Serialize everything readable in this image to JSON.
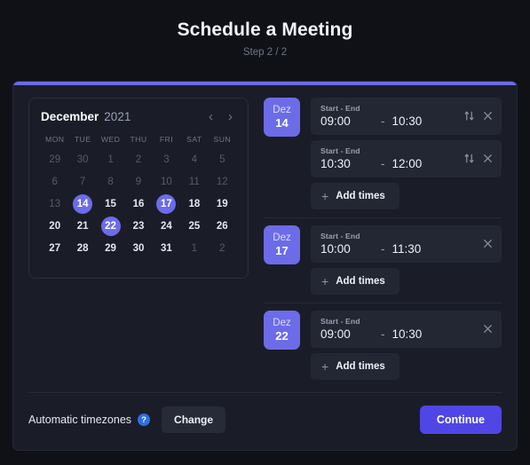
{
  "header": {
    "title": "Schedule a Meeting",
    "step": "Step 2 / 2"
  },
  "colors": {
    "accent": "#6c6ce8",
    "continue": "#4f46e5",
    "help": "#2f6fe0",
    "card_bg": "#1a1d28",
    "page_bg": "#0f1117",
    "field_bg": "#232734"
  },
  "calendar": {
    "month": "December",
    "year": "2021",
    "prev_icon": "chevron-left-icon",
    "next_icon": "chevron-right-icon",
    "weekdays": [
      "MON",
      "TUE",
      "WED",
      "THU",
      "FRI",
      "SAT",
      "SUN"
    ],
    "weeks": [
      [
        {
          "d": "29",
          "muted": true,
          "selected": false
        },
        {
          "d": "30",
          "muted": true,
          "selected": false
        },
        {
          "d": "1",
          "muted": true,
          "selected": false
        },
        {
          "d": "2",
          "muted": true,
          "selected": false
        },
        {
          "d": "3",
          "muted": true,
          "selected": false
        },
        {
          "d": "4",
          "muted": true,
          "selected": false
        },
        {
          "d": "5",
          "muted": true,
          "selected": false
        }
      ],
      [
        {
          "d": "6",
          "muted": true,
          "selected": false
        },
        {
          "d": "7",
          "muted": true,
          "selected": false
        },
        {
          "d": "8",
          "muted": true,
          "selected": false
        },
        {
          "d": "9",
          "muted": true,
          "selected": false
        },
        {
          "d": "10",
          "muted": true,
          "selected": false
        },
        {
          "d": "11",
          "muted": true,
          "selected": false
        },
        {
          "d": "12",
          "muted": true,
          "selected": false
        }
      ],
      [
        {
          "d": "13",
          "muted": true,
          "selected": false
        },
        {
          "d": "14",
          "muted": false,
          "selected": true
        },
        {
          "d": "15",
          "muted": false,
          "selected": false
        },
        {
          "d": "16",
          "muted": false,
          "selected": false
        },
        {
          "d": "17",
          "muted": false,
          "selected": true
        },
        {
          "d": "18",
          "muted": false,
          "selected": false
        },
        {
          "d": "19",
          "muted": false,
          "selected": false
        }
      ],
      [
        {
          "d": "20",
          "muted": false,
          "selected": false
        },
        {
          "d": "21",
          "muted": false,
          "selected": false
        },
        {
          "d": "22",
          "muted": false,
          "selected": true
        },
        {
          "d": "23",
          "muted": false,
          "selected": false
        },
        {
          "d": "24",
          "muted": false,
          "selected": false
        },
        {
          "d": "25",
          "muted": false,
          "selected": false
        },
        {
          "d": "26",
          "muted": false,
          "selected": false
        }
      ],
      [
        {
          "d": "27",
          "muted": false,
          "selected": false
        },
        {
          "d": "28",
          "muted": false,
          "selected": false
        },
        {
          "d": "29",
          "muted": false,
          "selected": false
        },
        {
          "d": "30",
          "muted": false,
          "selected": false
        },
        {
          "d": "31",
          "muted": false,
          "selected": false
        },
        {
          "d": "1",
          "muted": true,
          "selected": false
        },
        {
          "d": "2",
          "muted": true,
          "selected": false
        }
      ]
    ]
  },
  "slot_groups": [
    {
      "month_abbr": "Dez",
      "day": "14",
      "add_label": "Add times",
      "rows": [
        {
          "label": "Start - End",
          "start": "09:00",
          "dash": "-",
          "end": "10:30",
          "has_swap": true,
          "swap_icon": "swap-vertical-icon",
          "close_icon": "close-icon"
        },
        {
          "label": "Start - End",
          "start": "10:30",
          "dash": "-",
          "end": "12:00",
          "has_swap": true,
          "swap_icon": "swap-vertical-icon",
          "close_icon": "close-icon"
        }
      ]
    },
    {
      "month_abbr": "Dez",
      "day": "17",
      "add_label": "Add times",
      "rows": [
        {
          "label": "Start - End",
          "start": "10:00",
          "dash": "-",
          "end": "11:30",
          "has_swap": false,
          "swap_icon": "swap-vertical-icon",
          "close_icon": "close-icon"
        }
      ]
    },
    {
      "month_abbr": "Dez",
      "day": "22",
      "add_label": "Add times",
      "rows": [
        {
          "label": "Start - End",
          "start": "09:00",
          "dash": "-",
          "end": "10:30",
          "has_swap": false,
          "swap_icon": "swap-vertical-icon",
          "close_icon": "close-icon"
        }
      ]
    }
  ],
  "footer": {
    "timezone_label": "Automatic timezones",
    "help_icon": "help-circle-icon",
    "help_glyph": "?",
    "change_label": "Change",
    "continue_label": "Continue"
  }
}
